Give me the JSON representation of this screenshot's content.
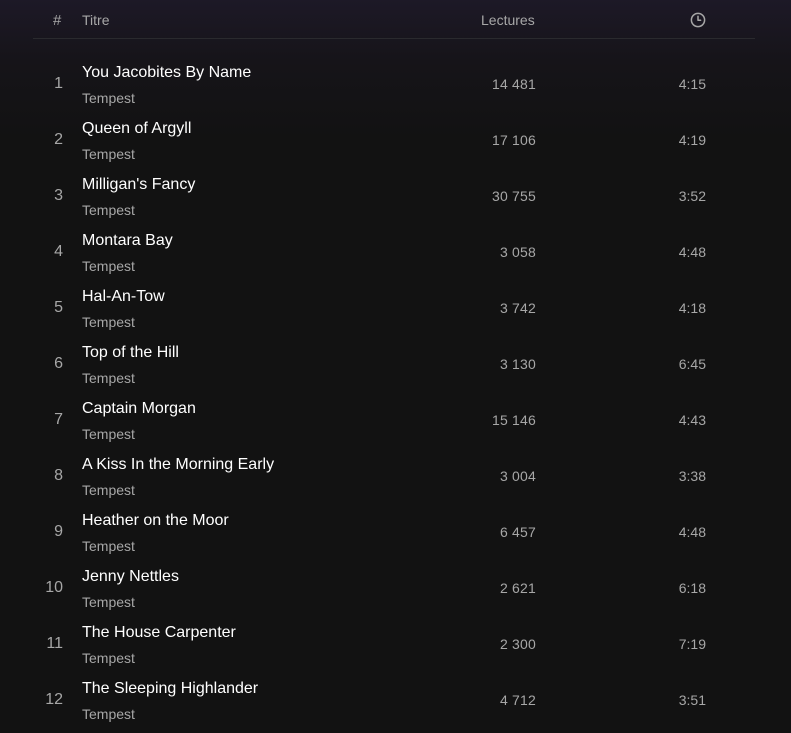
{
  "header": {
    "num_label": "#",
    "title_label": "Titre",
    "plays_label": "Lectures",
    "duration_icon": "clock-icon"
  },
  "tracks": [
    {
      "num": "1",
      "title": "You Jacobites By Name",
      "artist": "Tempest",
      "plays": "14 481",
      "duration": "4:15"
    },
    {
      "num": "2",
      "title": "Queen of Argyll",
      "artist": "Tempest",
      "plays": "17 106",
      "duration": "4:19"
    },
    {
      "num": "3",
      "title": "Milligan's Fancy",
      "artist": "Tempest",
      "plays": "30 755",
      "duration": "3:52"
    },
    {
      "num": "4",
      "title": "Montara Bay",
      "artist": "Tempest",
      "plays": "3 058",
      "duration": "4:48"
    },
    {
      "num": "5",
      "title": "Hal-An-Tow",
      "artist": "Tempest",
      "plays": "3 742",
      "duration": "4:18"
    },
    {
      "num": "6",
      "title": "Top of the Hill",
      "artist": "Tempest",
      "plays": "3 130",
      "duration": "6:45"
    },
    {
      "num": "7",
      "title": "Captain Morgan",
      "artist": "Tempest",
      "plays": "15 146",
      "duration": "4:43"
    },
    {
      "num": "8",
      "title": "A Kiss In the Morning Early",
      "artist": "Tempest",
      "plays": "3 004",
      "duration": "3:38"
    },
    {
      "num": "9",
      "title": "Heather on the Moor",
      "artist": "Tempest",
      "plays": "6 457",
      "duration": "4:48"
    },
    {
      "num": "10",
      "title": "Jenny Nettles",
      "artist": "Tempest",
      "plays": "2 621",
      "duration": "6:18"
    },
    {
      "num": "11",
      "title": "The House Carpenter",
      "artist": "Tempest",
      "plays": "2 300",
      "duration": "7:19"
    },
    {
      "num": "12",
      "title": "The Sleeping Highlander",
      "artist": "Tempest",
      "plays": "4 712",
      "duration": "3:51"
    }
  ]
}
